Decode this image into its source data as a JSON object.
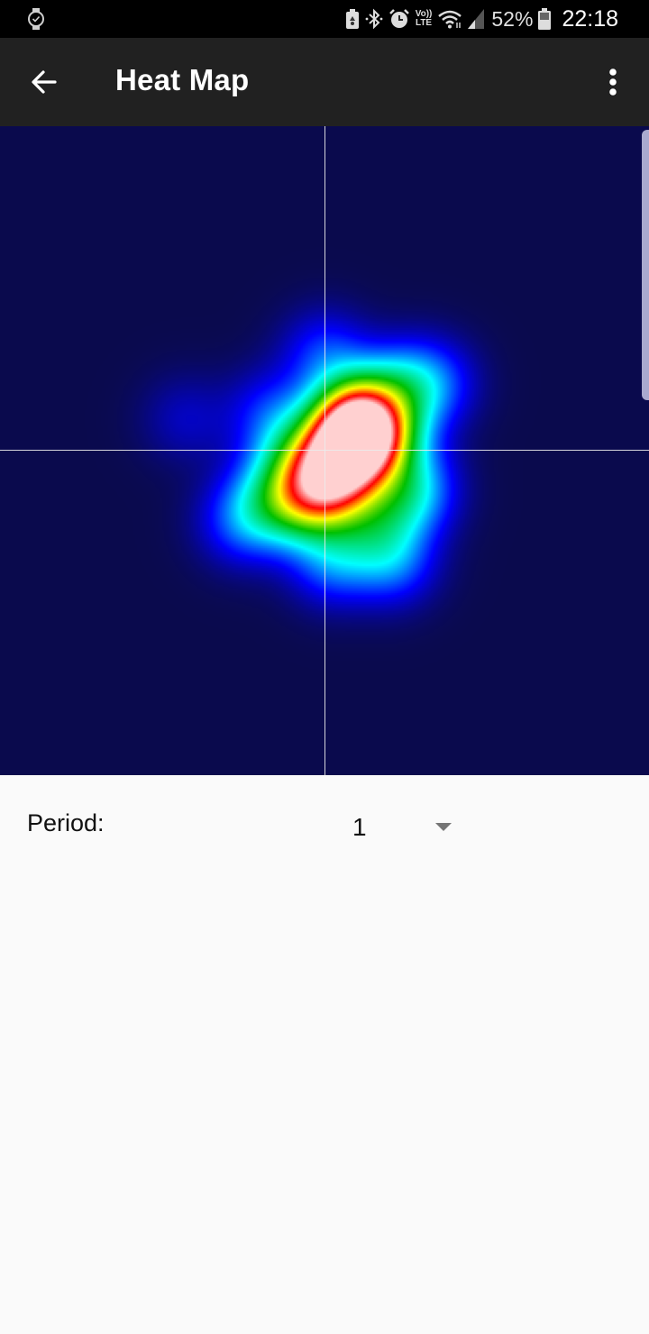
{
  "status_bar": {
    "icons": [
      "smartwatch-icon",
      "battery-saver-icon",
      "bluetooth-icon",
      "alarm-icon",
      "volte-icon",
      "wifi-icon",
      "signal-icon",
      "battery-icon"
    ],
    "volte_text_top": "Vo))",
    "volte_text_bottom": "LTE",
    "battery_percent": "52%",
    "time": "22:18"
  },
  "app_bar": {
    "title": "Heat Map",
    "back_icon": "arrow-back-icon",
    "menu_icon": "more-vert-icon"
  },
  "heatmap": {
    "background_color": "#0a0a4d",
    "crosshair_color": "#ebebeb",
    "colormap": [
      "#0a0a4d",
      "#0000ff",
      "#00ffff",
      "#00c000",
      "#ffff00",
      "#ff0000",
      "#ffd0d0"
    ],
    "chart_data": {
      "type": "heatmap",
      "title": "Heat Map",
      "xlabel": "",
      "ylabel": "",
      "xlim": [
        -1,
        1
      ],
      "ylim": [
        -1,
        1
      ],
      "crosshair_origin": [
        0,
        0
      ],
      "points": [
        {
          "x": 0.11,
          "y": 0.04,
          "w": 1.0
        },
        {
          "x": 0.09,
          "y": 0.08,
          "w": 0.9
        },
        {
          "x": 0.07,
          "y": 0.0,
          "w": 0.85
        },
        {
          "x": -0.01,
          "y": -0.13,
          "w": 0.95
        },
        {
          "x": 0.03,
          "y": -0.06,
          "w": 0.8
        },
        {
          "x": 0.1,
          "y": 0.12,
          "w": 0.6
        },
        {
          "x": -0.09,
          "y": -0.02,
          "w": 0.55
        },
        {
          "x": -0.1,
          "y": -0.16,
          "w": 0.5
        },
        {
          "x": 0.2,
          "y": 0.06,
          "w": 0.45
        },
        {
          "x": 0.22,
          "y": 0.2,
          "w": 0.45
        },
        {
          "x": 0.33,
          "y": 0.21,
          "w": 0.4
        },
        {
          "x": 0.26,
          "y": -0.12,
          "w": 0.4
        },
        {
          "x": 0.15,
          "y": -0.22,
          "w": 0.45
        },
        {
          "x": 0.21,
          "y": -0.34,
          "w": 0.42
        },
        {
          "x": 0.02,
          "y": -0.34,
          "w": 0.42
        },
        {
          "x": -0.26,
          "y": -0.22,
          "w": 0.35
        },
        {
          "x": -0.18,
          "y": -0.15,
          "w": 0.35
        },
        {
          "x": -0.17,
          "y": 0.12,
          "w": 0.3
        },
        {
          "x": 0.0,
          "y": 0.3,
          "w": 0.35
        },
        {
          "x": 0.27,
          "y": -0.12,
          "w": 0.25
        },
        {
          "x": -0.43,
          "y": 0.1,
          "w": 0.18
        }
      ]
    }
  },
  "controls": {
    "period_label": "Period:",
    "period_value": "1"
  }
}
